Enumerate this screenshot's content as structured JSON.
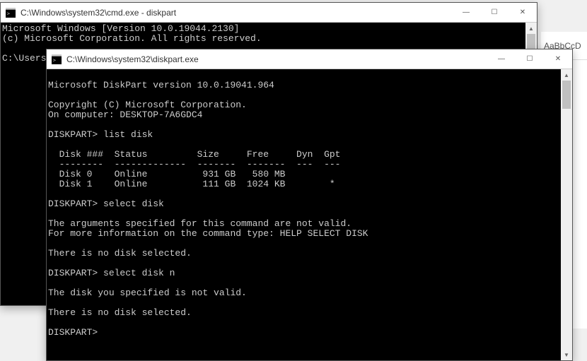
{
  "word_ribbon": {
    "style_tab": "AaBbCcD"
  },
  "cmd_window": {
    "title": "C:\\Windows\\system32\\cmd.exe - diskpart",
    "lines": [
      "Microsoft Windows [Version 10.0.19044.2130]",
      "(c) Microsoft Corporation. All rights reserved.",
      "",
      "C:\\Users\\hp"
    ]
  },
  "dp_window": {
    "title": "C:\\Windows\\system32\\diskpart.exe",
    "lines": [
      "",
      "Microsoft DiskPart version 10.0.19041.964",
      "",
      "Copyright (C) Microsoft Corporation.",
      "On computer: DESKTOP-7A6GDC4",
      "",
      "DISKPART> list disk",
      "",
      "  Disk ###  Status         Size     Free     Dyn  Gpt",
      "  --------  -------------  -------  -------  ---  ---",
      "  Disk 0    Online          931 GB   580 MB",
      "  Disk 1    Online          111 GB  1024 KB        *",
      "",
      "DISKPART> select disk",
      "",
      "The arguments specified for this command are not valid.",
      "For more information on the command type: HELP SELECT DISK",
      "",
      "There is no disk selected.",
      "",
      "DISKPART> select disk n",
      "",
      "The disk you specified is not valid.",
      "",
      "There is no disk selected.",
      "",
      "DISKPART>"
    ]
  },
  "win_buttons": {
    "min": "—",
    "max": "☐",
    "close": "✕"
  },
  "scroll": {
    "up": "▲",
    "down": "▼"
  }
}
